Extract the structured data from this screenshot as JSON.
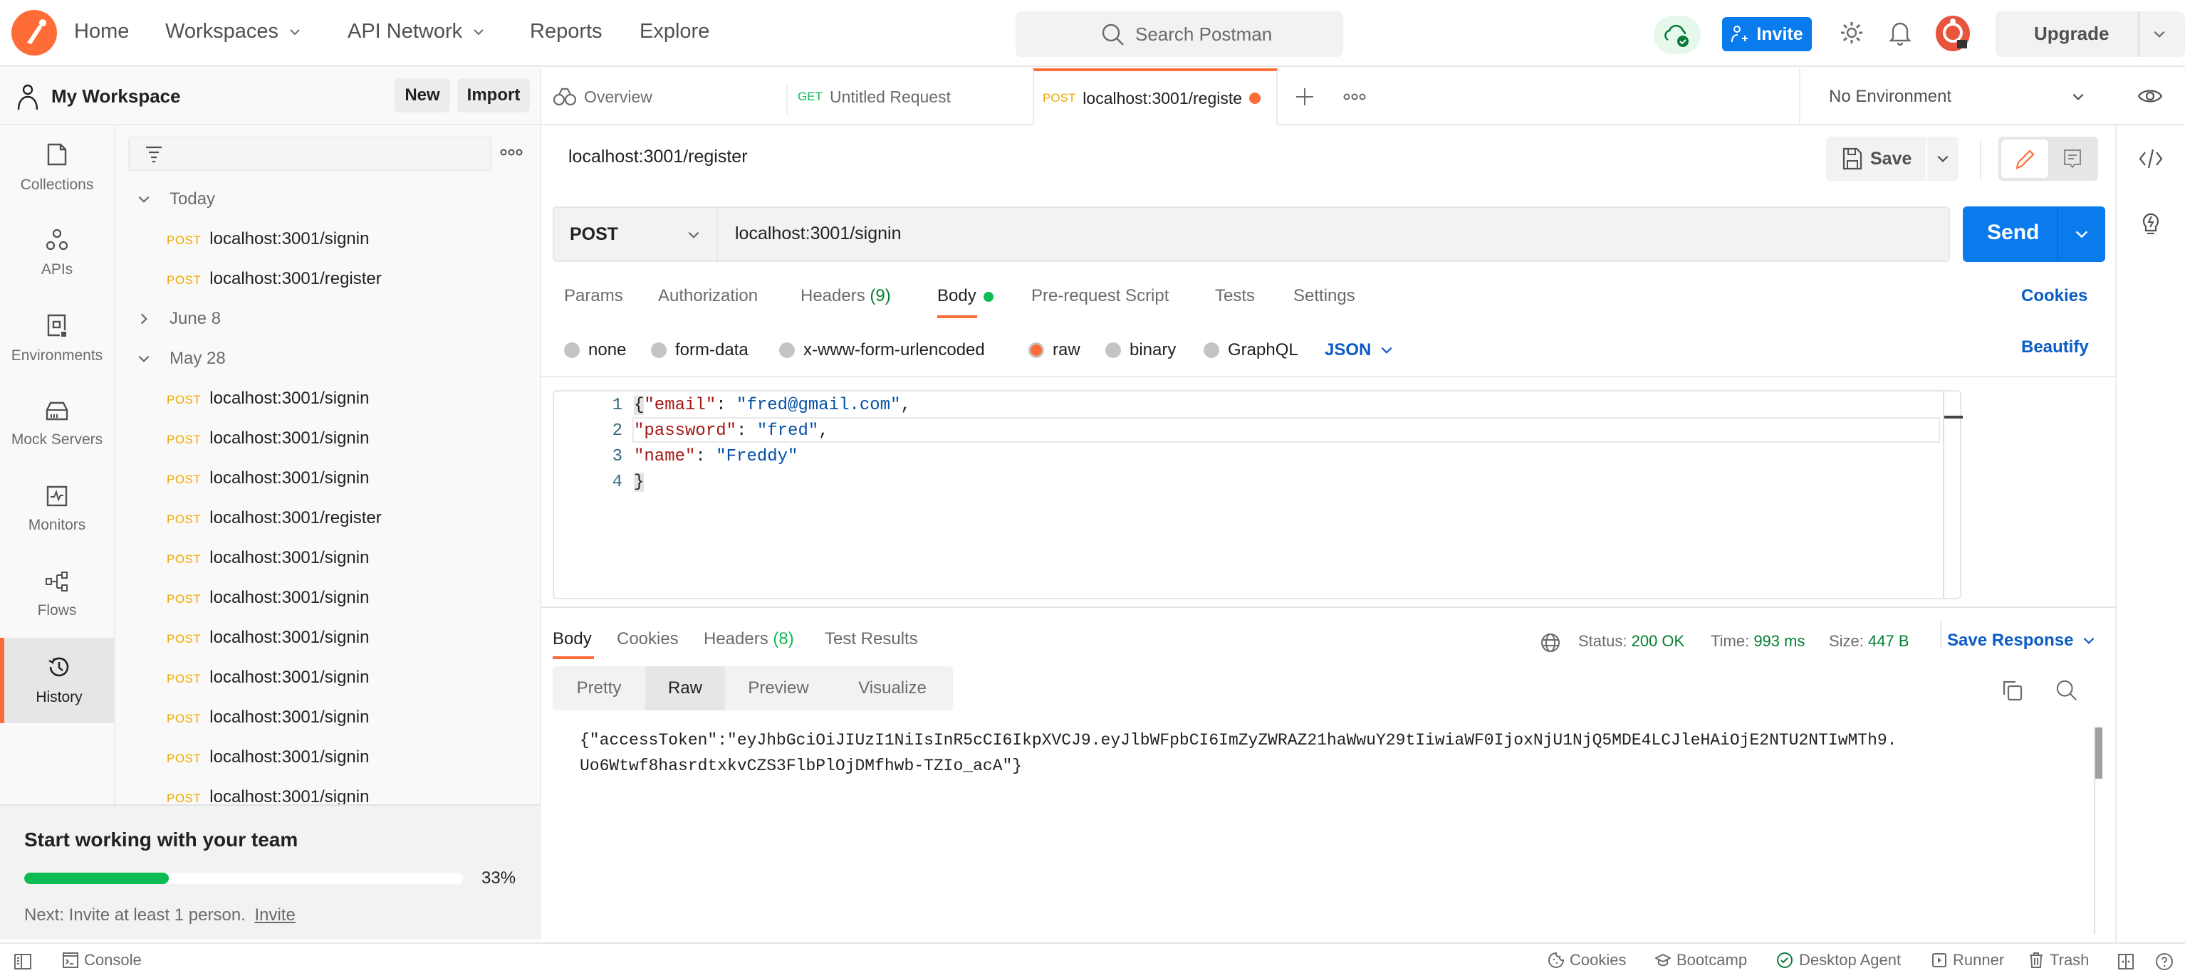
{
  "header": {
    "nav": [
      "Home",
      "Workspaces",
      "API Network",
      "Reports",
      "Explore"
    ],
    "search_placeholder": "Search Postman",
    "invite_label": "Invite",
    "upgrade_label": "Upgrade"
  },
  "workspace": {
    "name": "My Workspace",
    "new_label": "New",
    "import_label": "Import"
  },
  "sidebar": {
    "items": [
      {
        "label": "Collections",
        "icon": "collections-icon"
      },
      {
        "label": "APIs",
        "icon": "apis-icon"
      },
      {
        "label": "Environments",
        "icon": "environments-icon"
      },
      {
        "label": "Mock Servers",
        "icon": "mock-servers-icon"
      },
      {
        "label": "Monitors",
        "icon": "monitors-icon"
      },
      {
        "label": "Flows",
        "icon": "flows-icon"
      },
      {
        "label": "History",
        "icon": "history-icon",
        "active": true
      }
    ]
  },
  "history": {
    "groups": [
      {
        "label": "Today",
        "expanded": true,
        "items": [
          {
            "method": "POST",
            "url": "localhost:3001/signin"
          },
          {
            "method": "POST",
            "url": "localhost:3001/register"
          }
        ]
      },
      {
        "label": "June 8",
        "expanded": false,
        "items": []
      },
      {
        "label": "May 28",
        "expanded": true,
        "items": [
          {
            "method": "POST",
            "url": "localhost:3001/signin"
          },
          {
            "method": "POST",
            "url": "localhost:3001/signin"
          },
          {
            "method": "POST",
            "url": "localhost:3001/signin"
          },
          {
            "method": "POST",
            "url": "localhost:3001/register"
          },
          {
            "method": "POST",
            "url": "localhost:3001/signin"
          },
          {
            "method": "POST",
            "url": "localhost:3001/signin"
          },
          {
            "method": "POST",
            "url": "localhost:3001/signin"
          },
          {
            "method": "POST",
            "url": "localhost:3001/signin"
          },
          {
            "method": "POST",
            "url": "localhost:3001/signin"
          },
          {
            "method": "POST",
            "url": "localhost:3001/signin"
          },
          {
            "method": "POST",
            "url": "localhost:3001/signin"
          }
        ]
      }
    ]
  },
  "onboarding": {
    "title": "Start working with your team",
    "progress_percent": 33,
    "progress_label": "33%",
    "next_text": "Next: Invite at least 1 person.",
    "next_link": "Invite"
  },
  "tabs": [
    {
      "method": "",
      "label": "Overview"
    },
    {
      "method": "GET",
      "label": "Untitled Request"
    },
    {
      "method": "POST",
      "label": "localhost:3001/registe",
      "active": true,
      "unsaved": true
    }
  ],
  "environment": {
    "selected": "No Environment"
  },
  "request": {
    "title": "localhost:3001/register",
    "save_label": "Save",
    "method": "POST",
    "url": "localhost:3001/signin",
    "send_label": "Send",
    "subtabs": [
      {
        "label": "Params"
      },
      {
        "label": "Authorization"
      },
      {
        "label": "Headers",
        "count": "(9)"
      },
      {
        "label": "Body",
        "active": true
      },
      {
        "label": "Pre-request Script"
      },
      {
        "label": "Tests"
      },
      {
        "label": "Settings"
      }
    ],
    "cookies_label": "Cookies",
    "body_types": [
      "none",
      "form-data",
      "x-www-form-urlencoded",
      "raw",
      "binary",
      "GraphQL"
    ],
    "body_type_selected": "raw",
    "format": "JSON",
    "beautify_label": "Beautify",
    "body_lines": [
      {
        "n": "1",
        "key": "\"email\"",
        "value": "\"fred@gmail.com\"",
        "open": "{",
        "tail": ","
      },
      {
        "n": "2",
        "key": "\"password\"",
        "value": "\"fred\"",
        "open": "",
        "tail": ","
      },
      {
        "n": "3",
        "key": "\"name\"",
        "value": "\"Freddy\"",
        "open": "",
        "tail": ""
      },
      {
        "n": "4",
        "close": "}"
      }
    ]
  },
  "response": {
    "tabs": [
      {
        "label": "Body",
        "active": true
      },
      {
        "label": "Cookies"
      },
      {
        "label": "Headers",
        "count": "(8)"
      },
      {
        "label": "Test Results"
      }
    ],
    "status_label": "Status:",
    "status": "200 OK",
    "time_label": "Time:",
    "time": "993 ms",
    "size_label": "Size:",
    "size": "447 B",
    "save_response_label": "Save Response",
    "views": [
      "Pretty",
      "Raw",
      "Preview",
      "Visualize"
    ],
    "view_selected": "Raw",
    "raw_line1": "{\"accessToken\":\"eyJhbGciOiJIUzI1NiIsInR5cCI6IkpXVCJ9.eyJlbWFpbCI6ImZyZWRAZ21haWwuY29tIiwiaWF0IjoxNjU1NjQ5MDE4LCJleHAiOjE2NTU2NTIwMTh9.",
    "raw_line2": "Uo6Wtwf8hasrdtxkvCZS3FlbPlOjDMfhwb-TZIo_acA\"}"
  },
  "statusbar": {
    "console_label": "Console",
    "items": [
      "Cookies",
      "Bootcamp",
      "Desktop Agent",
      "Runner",
      "Trash"
    ]
  },
  "colors": {
    "brand": "#ff6c37",
    "primary": "#097bed",
    "post": "#eda900",
    "get": "#0cbb52",
    "success": "#007f31"
  }
}
